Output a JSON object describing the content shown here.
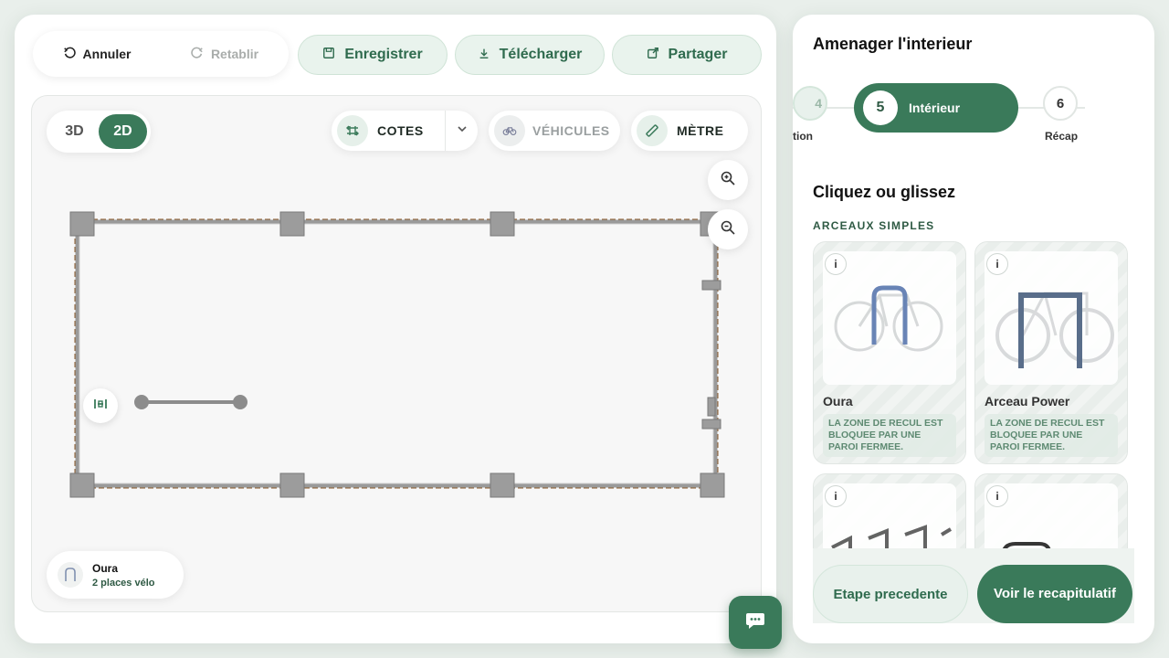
{
  "toolbar": {
    "undo_label": "Annuler",
    "redo_label": "Retablir",
    "save_label": "Enregistrer",
    "download_label": "Télécharger",
    "share_label": "Partager"
  },
  "view": {
    "opt_3d": "3D",
    "opt_2d": "2D",
    "active": "2D"
  },
  "canvas_tools": {
    "cotes_label": "COTES",
    "vehicules_label": "VÉHICULES",
    "metre_label": "MÈTRE"
  },
  "selected": {
    "name": "Oura",
    "capacity": "2 places vélo"
  },
  "sidebar": {
    "title": "Amenager l'interieur",
    "steps": {
      "prev_number": "4",
      "prev_label": "tion",
      "current_number": "5",
      "current_label": "Intérieur",
      "next_number": "6",
      "next_label": "Récap"
    },
    "subtitle": "Cliquez ou glissez",
    "section": "ARCEAUX SIMPLES",
    "products": [
      {
        "name": "Oura",
        "warning": "LA ZONE DE RECUL EST BLOQUEE PAR UNE PAROI FERMEE."
      },
      {
        "name": "Arceau Power",
        "warning": "LA ZONE DE RECUL EST BLOQUEE PAR UNE PAROI FERMEE."
      }
    ],
    "prev_button": "Etape precedente",
    "next_button": "Voir le recapitulatif"
  },
  "colors": {
    "brand_green": "#3a7a5a",
    "light_green": "#e9f3ed",
    "text_dark": "#1f2a24"
  }
}
